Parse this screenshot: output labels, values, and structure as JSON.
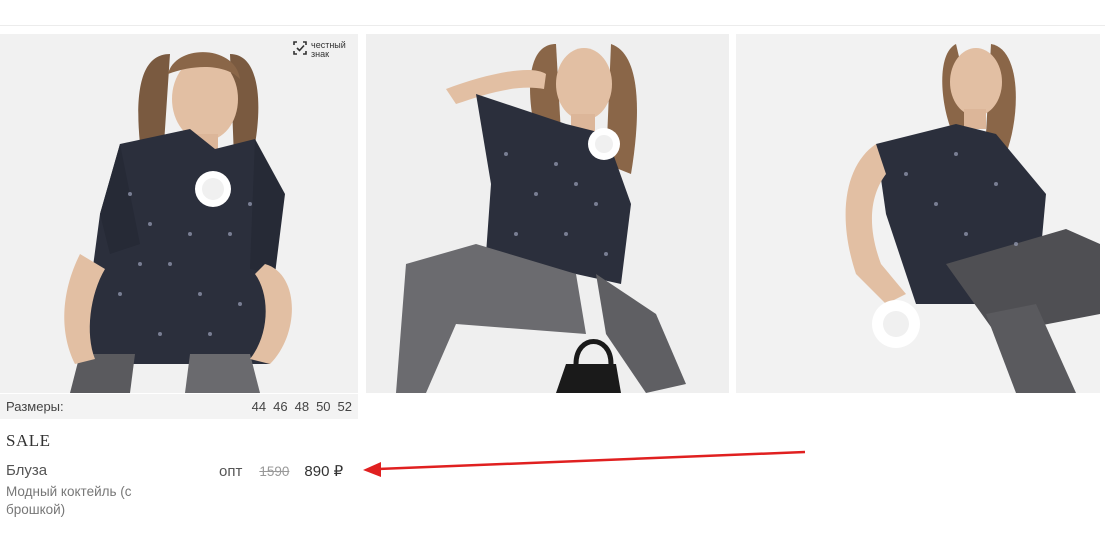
{
  "badge": {
    "line1": "честный",
    "line2": "знак",
    "icon": "chz-mark-icon"
  },
  "product": {
    "sizes_label": "Размеры:",
    "sizes": [
      "44",
      "46",
      "48",
      "50",
      "52"
    ],
    "sale_label": "SALE",
    "name": "Блуза",
    "description": "Модный коктейль (с брошкой)",
    "price_prefix": "опт",
    "old_price": "1590",
    "new_price": "890 ₽"
  },
  "photos": [
    {
      "icon": "product-photo-front"
    },
    {
      "icon": "product-photo-seated"
    },
    {
      "icon": "product-photo-side"
    }
  ],
  "colors": {
    "annotation_arrow": "#e02020",
    "print_dark": "#2b2f3c"
  }
}
